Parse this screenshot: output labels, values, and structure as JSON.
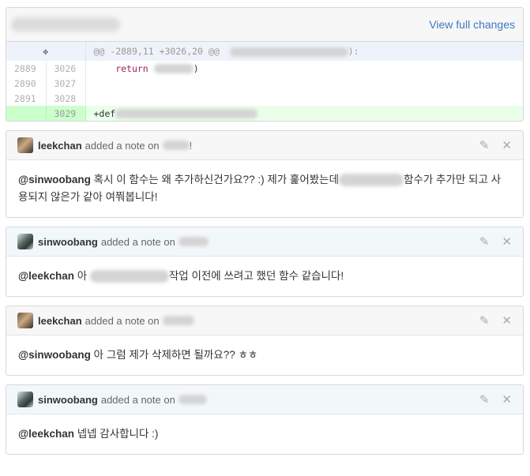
{
  "diff": {
    "view_link": "View full changes",
    "hunk_header": "@@ -2889,11 +3026,20 @@",
    "rows": [
      {
        "old": "2889",
        "new": "3026",
        "code_prefix": "    return",
        "type": "context"
      },
      {
        "old": "2890",
        "new": "3027",
        "code_prefix": "",
        "type": "context"
      },
      {
        "old": "2891",
        "new": "3028",
        "code_prefix": "",
        "type": "context"
      },
      {
        "old": "",
        "new": "3029",
        "code_prefix": "+def",
        "type": "add"
      }
    ]
  },
  "notes": [
    {
      "author": "leekchan",
      "action": "added a note on",
      "body_mention": "@sinwoobang",
      "body_before": " 혹시 이 함수는 왜 추가하신건가요?? :) 제가 훑어봤는데",
      "body_after": "함수가 추가만 되고 사용되지 않은가 같아 여쭤봅니다!",
      "has_redaction": true,
      "redaction_width": 82
    },
    {
      "author": "sinwoobang",
      "action": "added a note on",
      "body_mention": "@leekchan",
      "body_before": " 아 ",
      "body_after": "작업 이전에 쓰려고 했던 함수 같습니다!",
      "has_redaction": true,
      "redaction_width": 100
    },
    {
      "author": "leekchan",
      "action": "added a note on",
      "body_mention": "@sinwoobang",
      "body_before": " 아 그럼 제가 삭제하면 될까요?? ㅎㅎ",
      "body_after": "",
      "has_redaction": false
    },
    {
      "author": "sinwoobang",
      "action": "added a note on",
      "body_mention": "@leekchan",
      "body_before": " 넵넵 감사합니다 :)",
      "body_after": "",
      "has_redaction": false
    }
  ],
  "icons": {
    "expand": "expand-icon",
    "edit": "pencil-icon",
    "close": "close-icon"
  }
}
